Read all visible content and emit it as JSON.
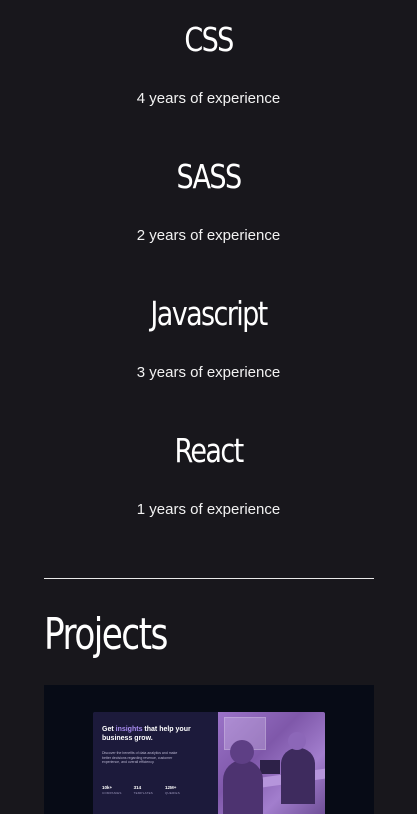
{
  "skills": [
    {
      "name": "CSS",
      "experience": "4 years of experience"
    },
    {
      "name": "SASS",
      "experience": "2 years of experience"
    },
    {
      "name": "Javascript",
      "experience": "3 years of experience"
    },
    {
      "name": "React",
      "experience": "1 years of experience"
    }
  ],
  "projects": {
    "title": "Projects",
    "card": {
      "headline_pre": "Get ",
      "headline_accent": "insights",
      "headline_post": " that help your business grow.",
      "description": "Discover the benefits of data analytics and make better decisions regarding revenue, customer experience, and overall efficiency.",
      "stats": [
        {
          "value": "10k+",
          "label": "COMPANIES"
        },
        {
          "value": "314",
          "label": "TEMPLATES"
        },
        {
          "value": "12M+",
          "label": "QUERIES"
        }
      ]
    }
  },
  "colors": {
    "background": "#18171c",
    "card_background": "#070b16",
    "accent": "#a88cf0"
  }
}
